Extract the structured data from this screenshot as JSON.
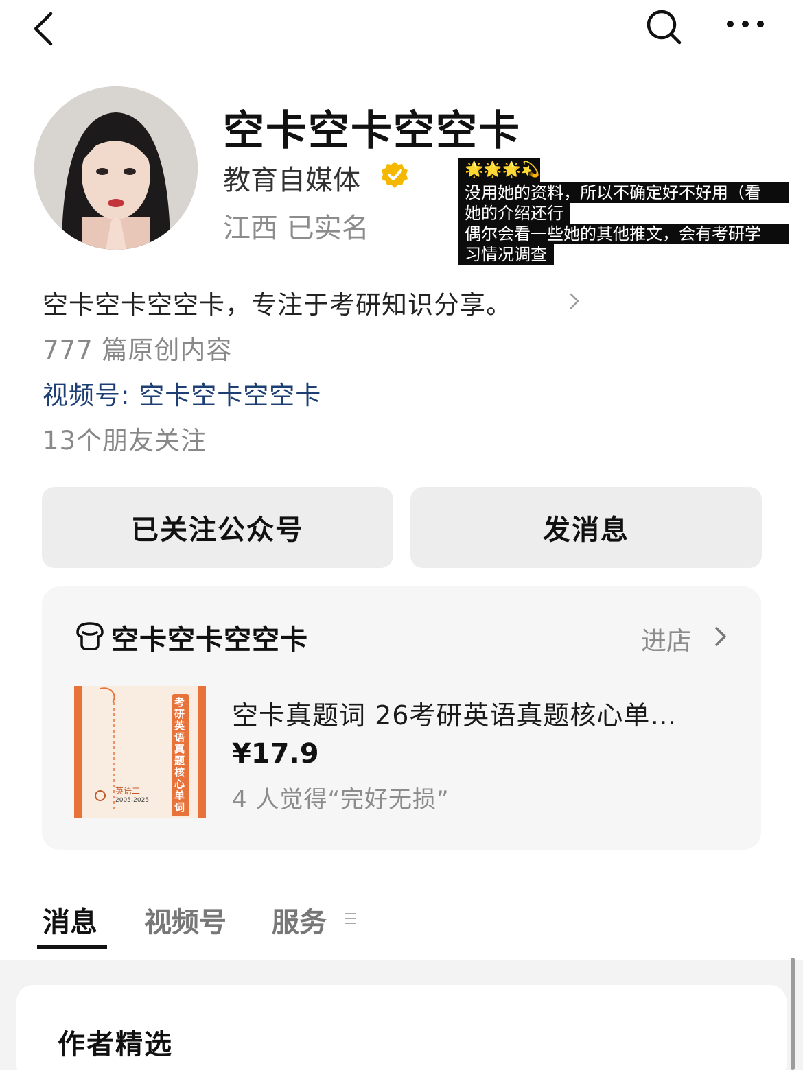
{
  "topbar": {
    "back_icon": "chevron-left-icon",
    "search_icon": "search-icon",
    "more_icon": "more-dots-icon"
  },
  "profile": {
    "name": "空卡空卡空空卡",
    "category": "教育自媒体",
    "verified_icon": "verified-badge-icon",
    "verified_color": "#f5b800",
    "location": "江西  已实名"
  },
  "note": {
    "stars": "🌟🌟🌟💫",
    "lines": [
      "没用她的资料，所以不确定好不好用（看",
      "她的介绍还行",
      "偶尔会看一些她的其他推文，会有考研学",
      "习情况调查"
    ]
  },
  "info": {
    "description": "空卡空卡空空卡，专注于考研知识分享。",
    "original_count": "777 篇原创内容",
    "channel": "视频号: 空卡空卡空空卡",
    "friends_follow": "13个朋友关注",
    "link_color": "#1e3f73"
  },
  "actions": {
    "follow_label": "已关注公众号",
    "message_label": "发消息"
  },
  "shop": {
    "icon": "shop-icon",
    "name": "空卡空卡空空卡",
    "enter_label": "进店",
    "product": {
      "title": "空卡真题词 26考研英语真题核心单…",
      "price": "¥17.9",
      "review": "4 人觉得“完好无损”",
      "cover_text": "考研英语真题核心单词",
      "cover_sub": "英语二",
      "cover_years": "2005-2025",
      "cover_color": "#e8733a"
    }
  },
  "tabs": [
    {
      "label": "消息",
      "active": true
    },
    {
      "label": "视频号",
      "active": false
    },
    {
      "label": "服务",
      "active": false
    }
  ],
  "section": {
    "title": "作者精选"
  }
}
